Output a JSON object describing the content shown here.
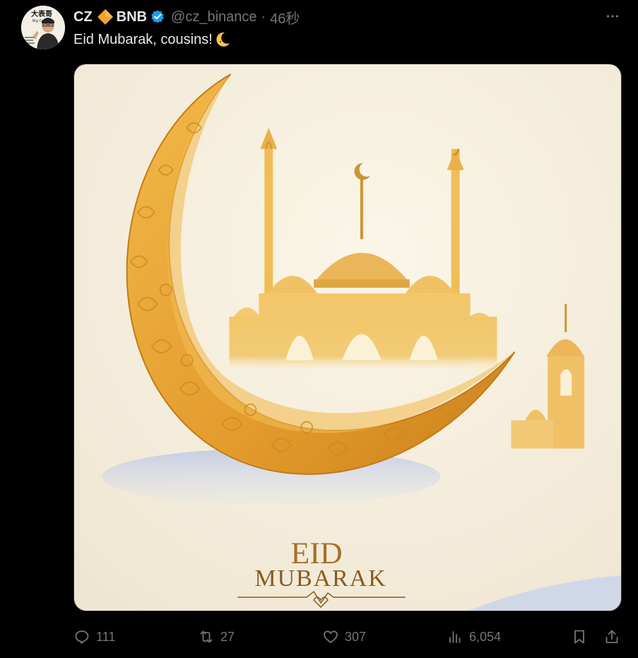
{
  "tweet": {
    "author": {
      "name": "CZ",
      "affiliation": "BNB",
      "handle": "@cz_binance",
      "separator": "·",
      "time": "46秒",
      "avatar_caption": "大表哥",
      "avatar_subcaption": "Big Cousin"
    },
    "text": "Eid Mubarak, cousins!",
    "image": {
      "title_line1": "EID",
      "title_line2": "MUBARAK"
    },
    "actions": {
      "replies": "111",
      "reposts": "27",
      "likes": "307",
      "views": "6,054"
    },
    "icons": {
      "more": "more-icon",
      "reply": "reply-icon",
      "repost": "repost-icon",
      "like": "heart-icon",
      "views": "views-icon",
      "bookmark": "bookmark-icon",
      "share": "share-icon",
      "verified": "verified-icon",
      "affiliate": "bnb-diamond-icon",
      "emoji": "crescent-moon-emoji"
    },
    "colors": {
      "background": "#000000",
      "text": "#e7e9ea",
      "muted": "#71767b",
      "verified": "#1d9bf0",
      "bnb": "#f3a030",
      "gold": "#e6a53a"
    }
  }
}
